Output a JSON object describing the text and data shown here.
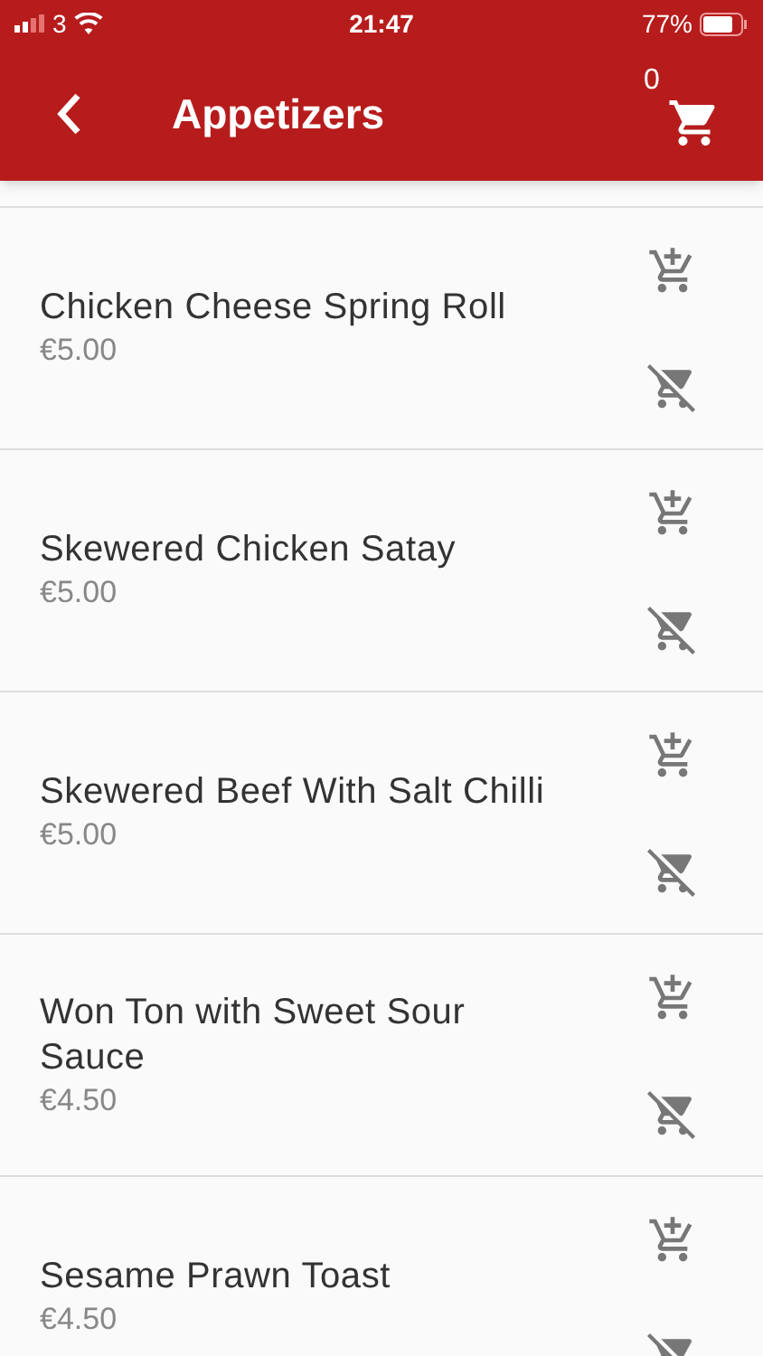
{
  "status_bar": {
    "carrier": "3",
    "time": "21:47",
    "battery": "77%"
  },
  "header": {
    "title": "Appetizers",
    "cart_count": "0"
  },
  "items": [
    {
      "name": "Chicken Cheese Spring Roll",
      "price": "€5.00"
    },
    {
      "name": "Skewered Chicken Satay",
      "price": "€5.00"
    },
    {
      "name": "Skewered Beef With Salt Chilli",
      "price": "€5.00"
    },
    {
      "name": "Won Ton with Sweet Sour Sauce",
      "price": "€4.50"
    },
    {
      "name": "Sesame Prawn Toast",
      "price": "€4.50"
    }
  ]
}
